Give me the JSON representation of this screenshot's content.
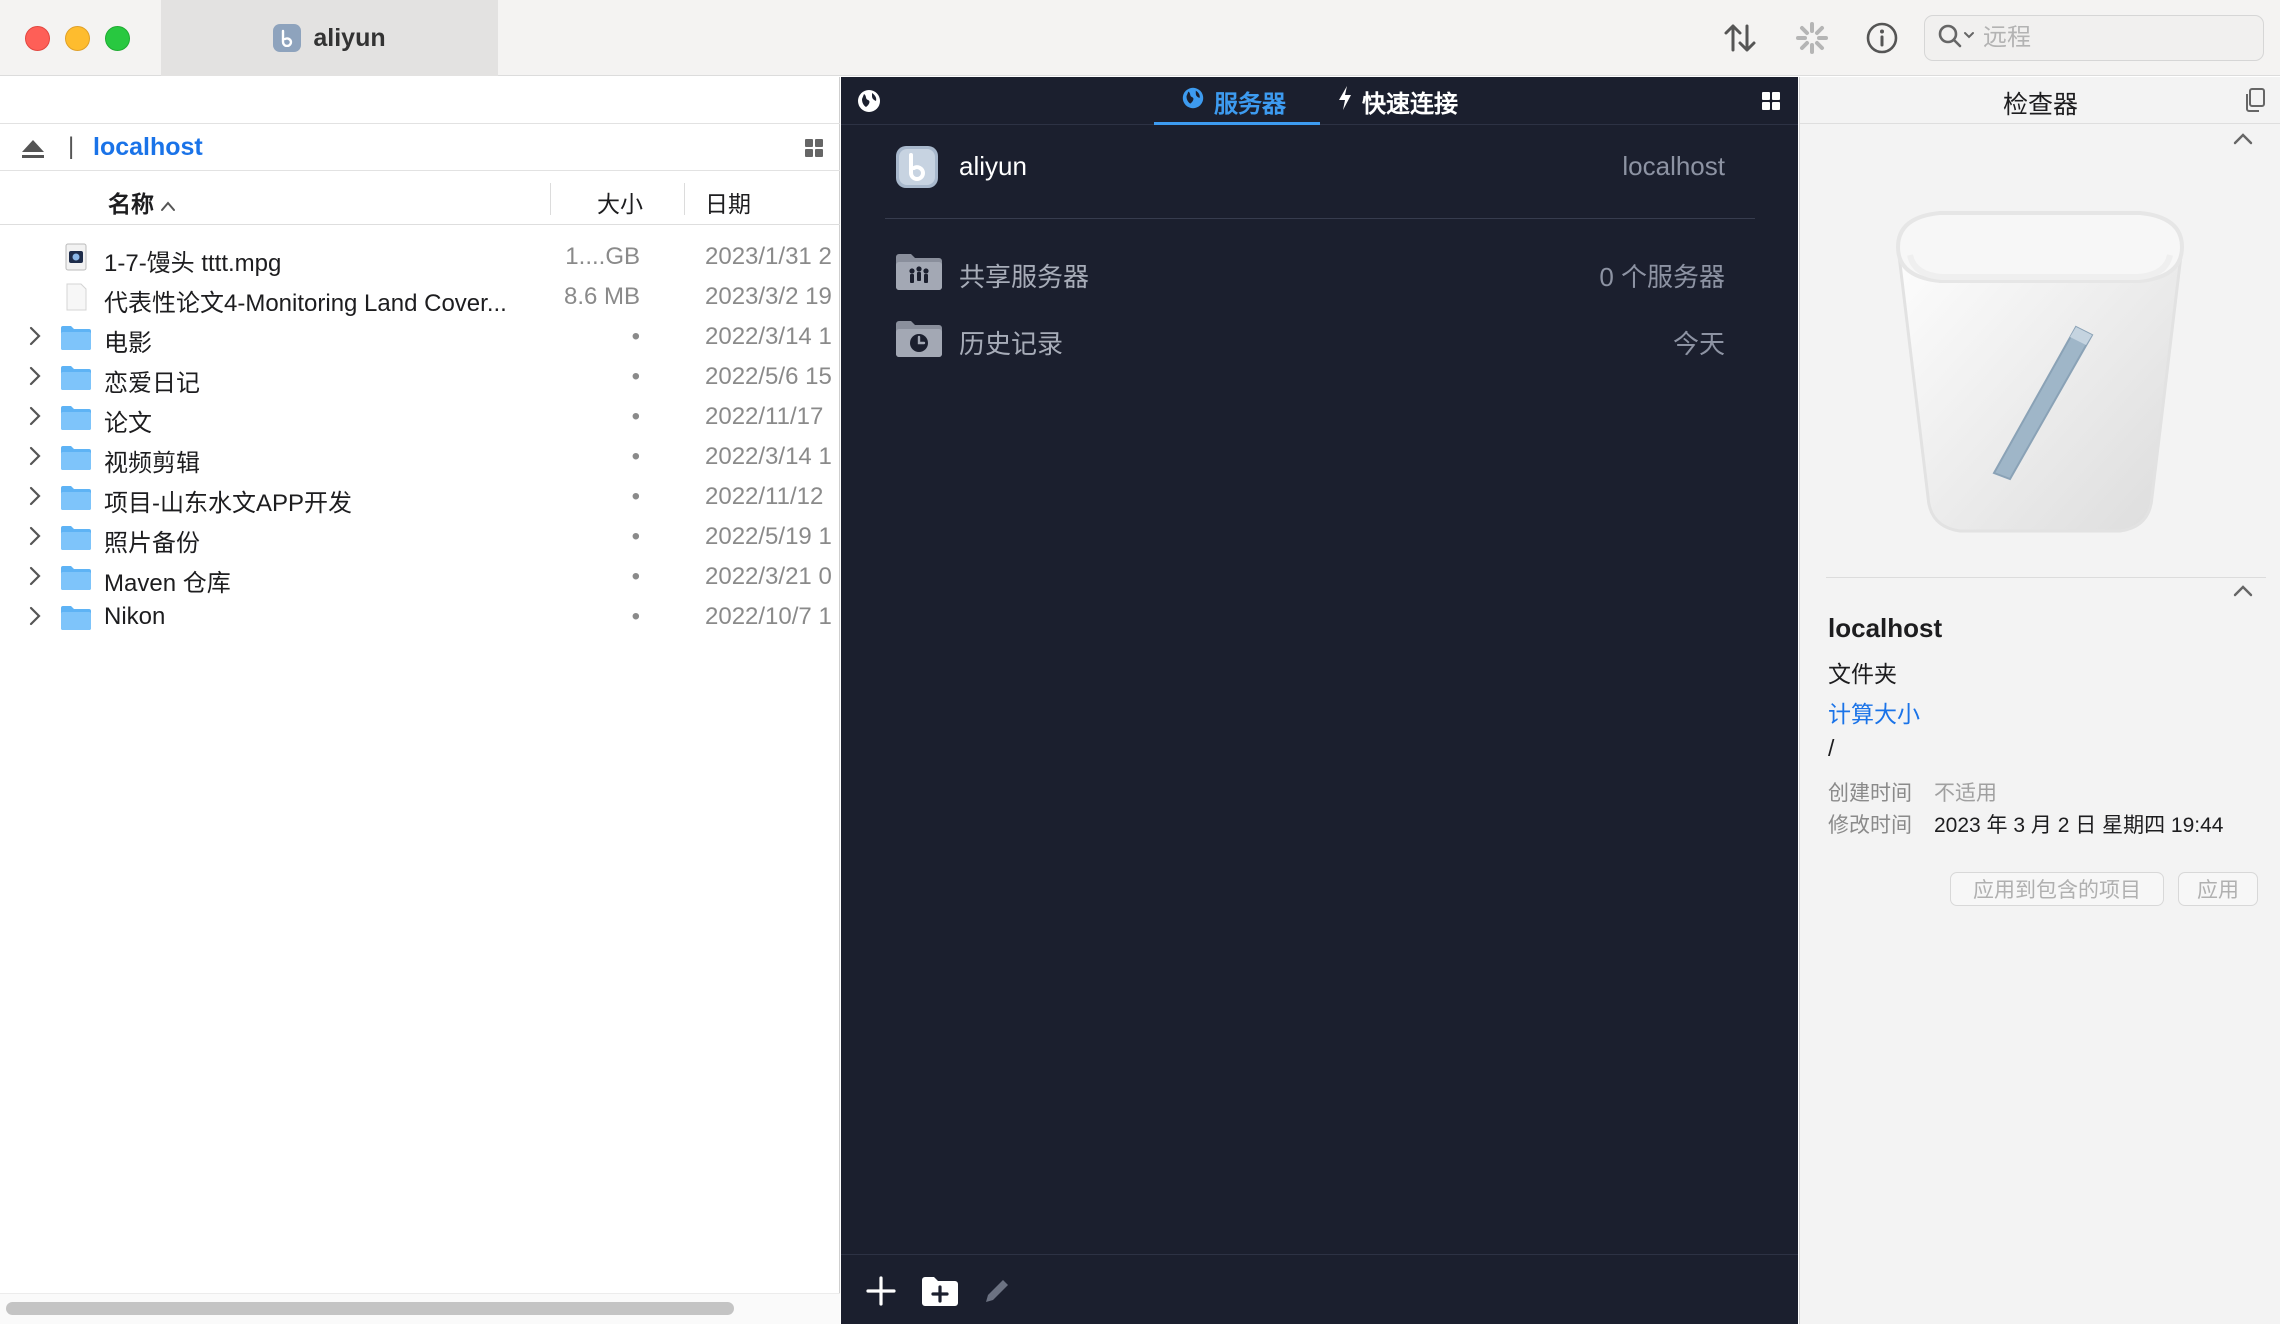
{
  "window": {
    "tab_title": "aliyun",
    "search_placeholder": "远程"
  },
  "left": {
    "path": "localhost",
    "path_separator": "|",
    "columns": {
      "name": "名称",
      "size": "大小",
      "date": "日期"
    },
    "files": [
      {
        "name": "1-7-馒头 tttt.mpg",
        "size": "1....GB",
        "date": "2023/1/31 2",
        "kind": "video"
      },
      {
        "name": "代表性论文4-Monitoring Land Cover...",
        "size": "8.6 MB",
        "date": "2023/3/2 19",
        "kind": "doc"
      },
      {
        "name": "电影",
        "size": "•",
        "date": "2022/3/14 1",
        "kind": "folder"
      },
      {
        "name": "恋爱日记",
        "size": "•",
        "date": "2022/5/6 15",
        "kind": "folder"
      },
      {
        "name": "论文",
        "size": "•",
        "date": "2022/11/17",
        "kind": "folder"
      },
      {
        "name": "视频剪辑",
        "size": "•",
        "date": "2022/3/14 1",
        "kind": "folder"
      },
      {
        "name": "项目-山东水文APP开发",
        "size": "•",
        "date": "2022/11/12",
        "kind": "folder"
      },
      {
        "name": "照片备份",
        "size": "•",
        "date": "2022/5/19 1",
        "kind": "folder"
      },
      {
        "name": "Maven 仓库",
        "size": "•",
        "date": "2022/3/21 0",
        "kind": "folder"
      },
      {
        "name": "Nikon",
        "size": "•",
        "date": "2022/10/7 1",
        "kind": "folder"
      }
    ]
  },
  "middle": {
    "tabs": {
      "servers": "服务器",
      "quick_connect": "快速连接"
    },
    "servers": [
      {
        "name": "aliyun",
        "value": "localhost"
      },
      {
        "name": "共享服务器",
        "value": "0 个服务器"
      },
      {
        "name": "历史记录",
        "value": "今天"
      }
    ]
  },
  "inspector": {
    "title": "检查器",
    "name": "localhost",
    "kind": "文件夹",
    "calc_size": "计算大小",
    "path": "/",
    "created_label": "创建时间",
    "created_value": "不适用",
    "modified_label": "修改时间",
    "modified_value": "2023 年 3 月 2 日 星期四 19:44",
    "btn_apply_enclosed": "应用到包含的项目",
    "btn_apply": "应用"
  },
  "colors": {
    "accent": "#3d9bf0",
    "link": "#1a73e8",
    "dark_panel": "#1b1f2e",
    "folder": "#5eb3f5"
  }
}
